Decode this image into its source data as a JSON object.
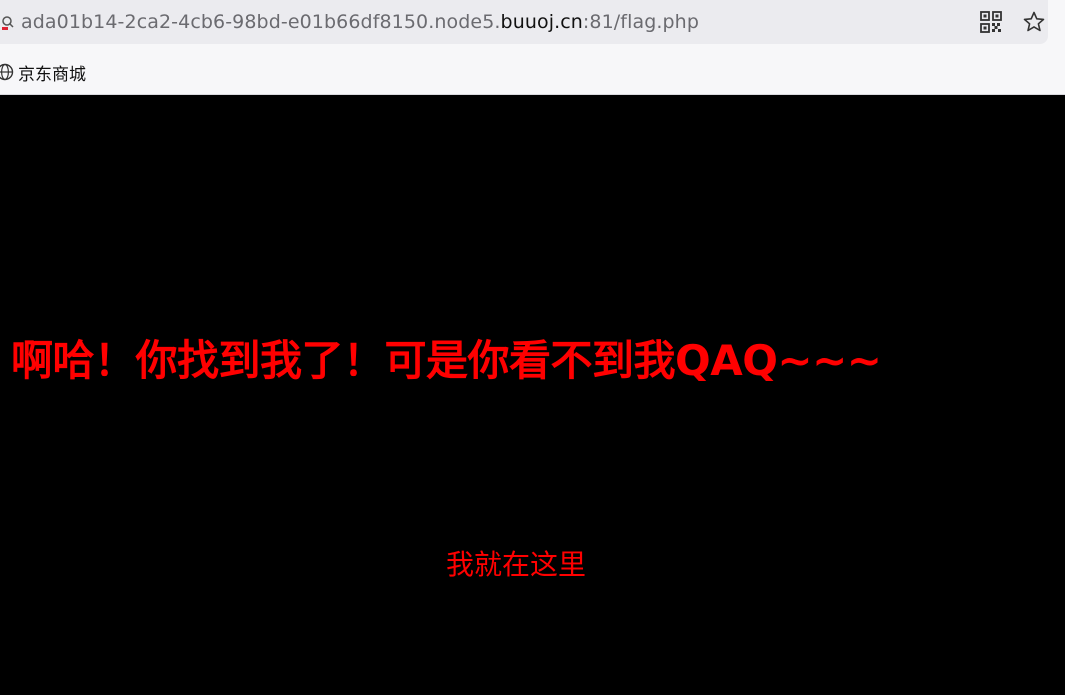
{
  "browser": {
    "url_prefix": "ada01b14-2ca2-4cb6-98bd-e01b66df8150.node5.",
    "url_domain": "buuoj.cn",
    "url_suffix": ":81/flag.php",
    "qr_icon": "qr-code-icon",
    "star_icon": "star-icon"
  },
  "bookmarks": {
    "items": [
      {
        "label": "京东商城",
        "icon": "globe-icon"
      }
    ]
  },
  "page": {
    "headline": "啊哈！你找到我了！可是你看不到我QAQ~~~",
    "hint": "我就在这里",
    "background_color": "#000000",
    "text_color": "#ff0000"
  }
}
